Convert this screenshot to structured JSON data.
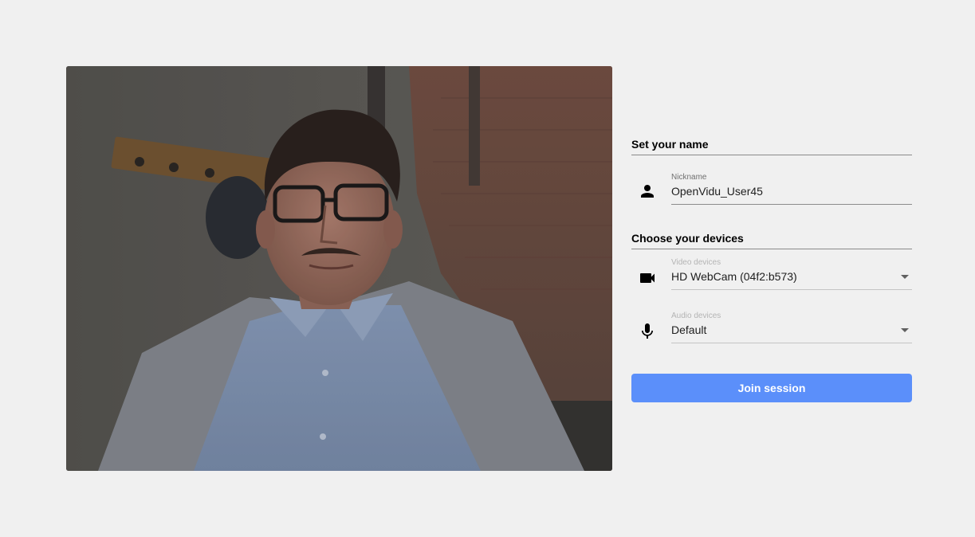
{
  "preview": {
    "label": "camera-preview"
  },
  "name_section": {
    "title": "Set your name",
    "nickname": {
      "label": "Nickname",
      "value": "OpenVidu_User45",
      "icon": "person-icon"
    }
  },
  "devices_section": {
    "title": "Choose your devices",
    "video": {
      "label": "Video devices",
      "value": "HD WebCam (04f2:b573)",
      "icon": "videocam-icon"
    },
    "audio": {
      "label": "Audio devices",
      "value": "Default",
      "icon": "mic-icon"
    }
  },
  "join_button": {
    "label": "Join session",
    "color": "#5b8ffa"
  },
  "colors": {
    "background": "#f0f0f0",
    "text": "#000000"
  }
}
